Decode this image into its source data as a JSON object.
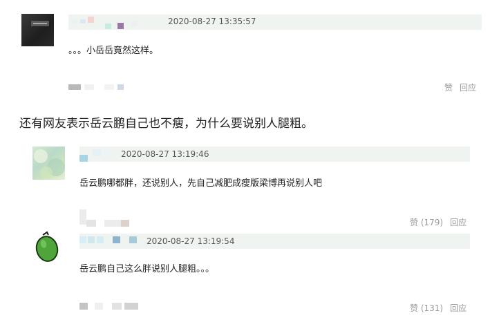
{
  "comments": [
    {
      "timestamp": "2020-08-27 13:35:57",
      "text": "。。。小岳岳竟然这样。",
      "like_label": "赞",
      "reply_label": "回应"
    },
    {
      "timestamp": "2020-08-27 13:19:46",
      "text": "岳云鹏哪都胖，还说别人，先自己减肥成瘦版梁博再说别人吧",
      "like_label": "赞 (179)",
      "reply_label": "回应"
    },
    {
      "timestamp": "2020-08-27 13:19:54",
      "text": "岳云鹏自己这么胖说别人腿粗。。。",
      "like_label": "赞 (131)",
      "reply_label": "回应"
    }
  ],
  "article_paragraph": "还有网友表示岳云鹏自己也不瘦，为什么要说别人腿粗。",
  "icons": [
    "avatar-dark-car",
    "avatar-green-scenery",
    "avatar-green-avocado"
  ]
}
